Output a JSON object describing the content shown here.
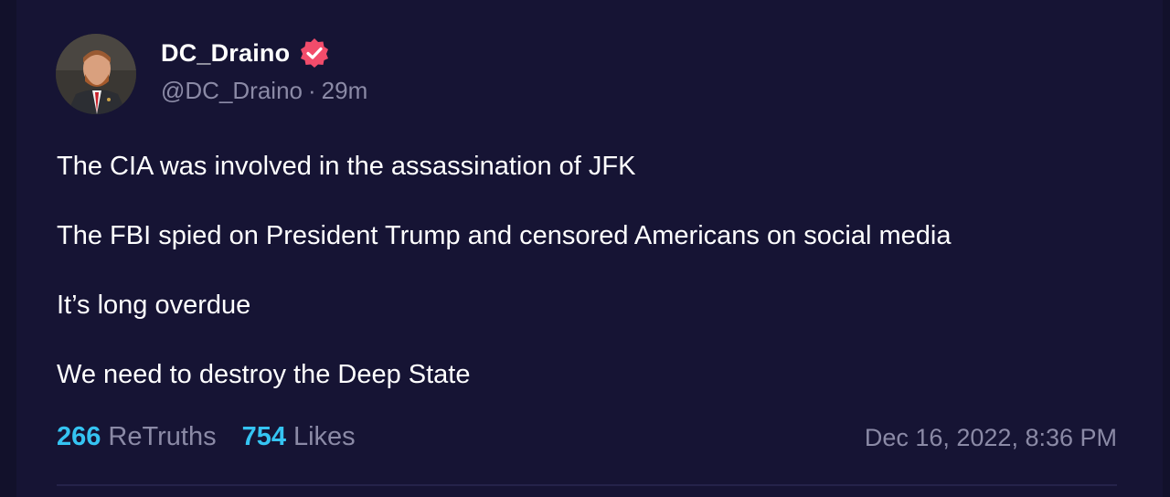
{
  "post": {
    "author": {
      "display_name": "DC_Draino",
      "handle": "@DC_Draino",
      "time_ago": "29m",
      "separator": "·",
      "avatar_icon": "profile-photo",
      "verified_icon": "verified-badge-icon",
      "verified_color": "#f24c6b"
    },
    "lines": [
      "The CIA was involved in the assassination of JFK",
      "The FBI spied on President Trump and censored Americans on social media",
      "It’s long overdue",
      "We need to destroy the Deep State"
    ],
    "stats": {
      "retruths_count": "266",
      "retruths_label": "ReTruths",
      "likes_count": "754",
      "likes_label": "Likes"
    },
    "timestamp": "Dec 16, 2022, 8:36 PM"
  },
  "colors": {
    "background": "#161434",
    "accent": "#35c4f2",
    "muted_text": "#8b8aa6",
    "text": "#ffffff"
  }
}
